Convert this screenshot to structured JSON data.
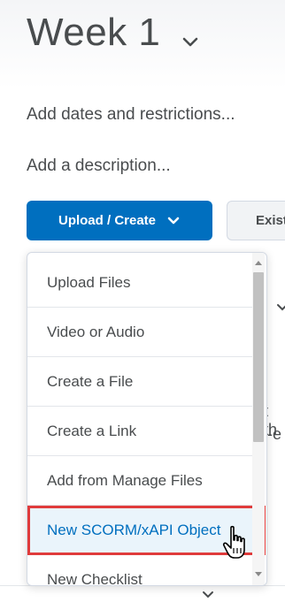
{
  "page": {
    "title": "Week 1",
    "add_dates": "Add dates and restrictions...",
    "add_description": "Add a description..."
  },
  "toolbar": {
    "upload_create_label": "Upload / Create",
    "existing_label": "Exist"
  },
  "dropdown": {
    "items": [
      {
        "label": "Upload Files"
      },
      {
        "label": "Video or Audio"
      },
      {
        "label": "Create a File"
      },
      {
        "label": "Create a Link"
      },
      {
        "label": "Add from Manage Files"
      },
      {
        "label": "New SCORM/xAPI Object"
      },
      {
        "label": "New Checklist"
      }
    ],
    "highlighted_index": 5
  },
  "background": {
    "partial_text_1": "t th",
    "partial_text_2": "-e"
  },
  "colors": {
    "primary": "#006fbf",
    "highlight_border": "#e03b3b",
    "highlight_bg": "#eaf4fb"
  }
}
